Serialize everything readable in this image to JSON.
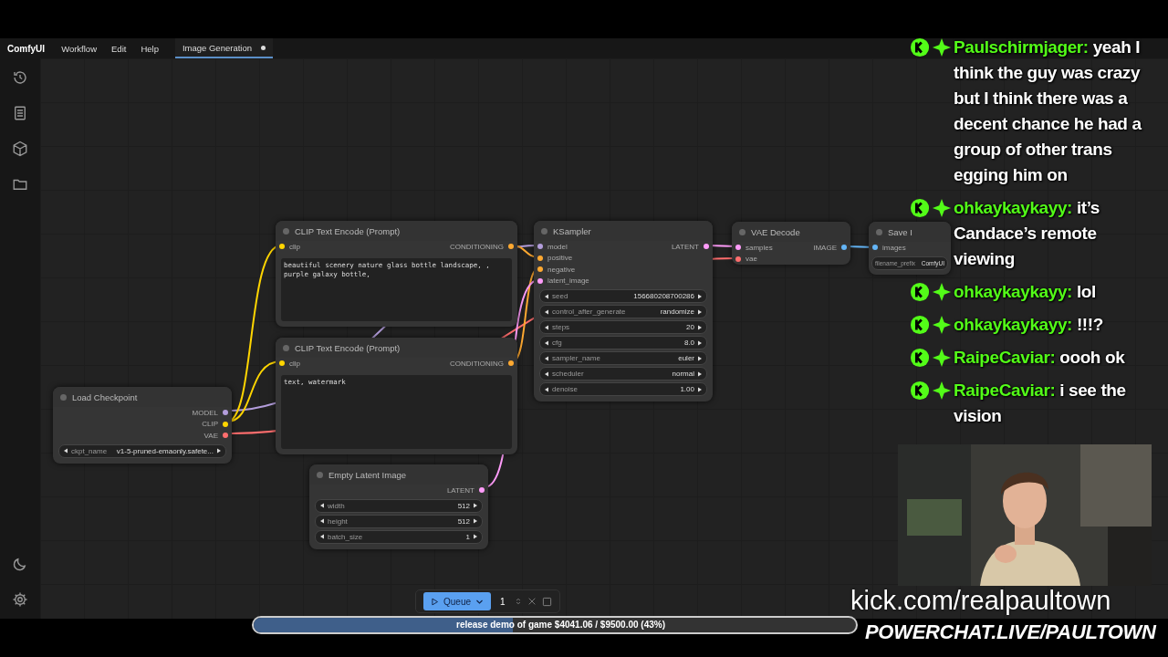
{
  "app": {
    "name": "ComfyUI"
  },
  "menu": [
    "Workflow",
    "Edit",
    "Help"
  ],
  "tabs": [
    {
      "label": "Image Generation",
      "selected": true
    }
  ],
  "nodes": [
    {
      "title": "CLIP Text Encode (Prompt)",
      "inputs": [
        {
          "name": "clip",
          "color": "#ffd500"
        }
      ],
      "outputs": [
        {
          "name": "CONDITIONING",
          "color": "#ffa931"
        }
      ],
      "text": "beautiful scenery nature glass bottle landscape, , purple galaxy bottle,"
    },
    {
      "title": "KSampler",
      "inputs": [
        {
          "name": "model",
          "color": "#b39ddb"
        },
        {
          "name": "positive",
          "color": "#ffa931"
        },
        {
          "name": "negative",
          "color": "#ffa931"
        },
        {
          "name": "latent_image",
          "color": "#ff9cf9"
        }
      ],
      "outputs": [
        {
          "name": "LATENT",
          "color": "#ff9cf9"
        }
      ],
      "widgets": [
        {
          "name": "seed",
          "value": "156680208700286"
        },
        {
          "name": "control_after_generate",
          "value": "randomize"
        },
        {
          "name": "steps",
          "value": "20"
        },
        {
          "name": "cfg",
          "value": "8.0"
        },
        {
          "name": "sampler_name",
          "value": "euler"
        },
        {
          "name": "scheduler",
          "value": "normal"
        },
        {
          "name": "denoise",
          "value": "1.00"
        }
      ]
    },
    {
      "title": "VAE Decode",
      "inputs": [
        {
          "name": "samples",
          "color": "#ff9cf9"
        },
        {
          "name": "vae",
          "color": "#ff6e6e"
        }
      ],
      "outputs": [
        {
          "name": "IMAGE",
          "color": "#64b5f6"
        }
      ]
    },
    {
      "title": "Save I",
      "inputs": [
        {
          "name": "images",
          "color": "#64b5f6"
        }
      ],
      "widgets": [
        {
          "name": "filename_prefix",
          "value": "ComfyUI"
        }
      ]
    },
    {
      "title": "CLIP Text Encode (Prompt)",
      "inputs": [
        {
          "name": "clip",
          "color": "#ffd500"
        }
      ],
      "outputs": [
        {
          "name": "CONDITIONING",
          "color": "#ffa931"
        }
      ],
      "text": "text, watermark"
    },
    {
      "title": "Load Checkpoint",
      "outputs": [
        {
          "name": "MODEL",
          "color": "#b39ddb"
        },
        {
          "name": "CLIP",
          "color": "#ffd500"
        },
        {
          "name": "VAE",
          "color": "#ff6e6e"
        }
      ],
      "widgets": [
        {
          "name": "ckpt_name",
          "value": "v1-5-pruned-emaonly.safete..."
        }
      ]
    },
    {
      "title": "Empty Latent Image",
      "outputs": [
        {
          "name": "LATENT",
          "color": "#ff9cf9"
        }
      ],
      "widgets": [
        {
          "name": "width",
          "value": "512"
        },
        {
          "name": "height",
          "value": "512"
        },
        {
          "name": "batch_size",
          "value": "1"
        }
      ]
    }
  ],
  "queue": {
    "label": "Queue",
    "count": "1"
  },
  "chat": [
    {
      "user": "Paulschirmjager:",
      "text": "yeah I think the guy was crazy but I think there was a decent chance he had a group of other trans egging him on"
    },
    {
      "user": "ohkaykaykayy:",
      "text": "it’s Candace’s remote viewing"
    },
    {
      "user": "ohkaykaykayy:",
      "text": "lol"
    },
    {
      "user": "ohkaykaykayy:",
      "text": "!!!?"
    },
    {
      "user": "RaipeCaviar:",
      "text": "oooh ok"
    },
    {
      "user": "RaipeCaviar:",
      "text": "i see the vision"
    }
  ],
  "overlay": {
    "url": "kick.com/realpaultown",
    "banner": "POWERCHAT.LIVE/PAULTOWN"
  },
  "goal": {
    "text": "release demo of game $4041.06 / $9500.00 (43%)",
    "level": 0.43
  }
}
